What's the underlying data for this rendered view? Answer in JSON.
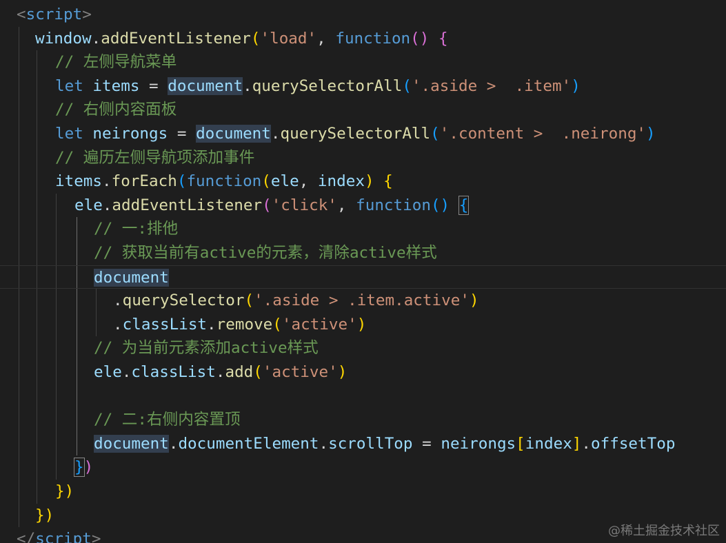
{
  "editor": {
    "theme": {
      "background": "#1e1e1e",
      "tag": "#569cd6",
      "keyword": "#569cd6",
      "variable": "#9cdcfe",
      "function": "#dcdcaa",
      "string": "#ce9178",
      "comment": "#6a9955",
      "plain": "#d4d4d4",
      "bracket_level_1": "#ffd700",
      "bracket_level_2": "#da70d6",
      "bracket_level_3": "#179fff"
    },
    "lines": [
      [
        [
          "<",
          "punct"
        ],
        [
          "script",
          "tag"
        ],
        [
          ">",
          "punct"
        ]
      ],
      [
        [
          "window",
          "var"
        ],
        [
          ".",
          "plain"
        ],
        [
          "addEventListener",
          "fn"
        ],
        [
          "(",
          "b1"
        ],
        [
          "'load'",
          "str"
        ],
        [
          ", ",
          "plain"
        ],
        [
          "function",
          "kw"
        ],
        [
          "()",
          "b2"
        ],
        [
          " ",
          "plain"
        ],
        [
          "{",
          "b2"
        ]
      ],
      [
        [
          "// 左侧导航菜单",
          "com"
        ]
      ],
      [
        [
          "let",
          "kw"
        ],
        [
          " ",
          "plain"
        ],
        [
          "items",
          "var"
        ],
        [
          " = ",
          "plain"
        ],
        [
          "document",
          "var",
          "sel"
        ],
        [
          ".",
          "plain"
        ],
        [
          "querySelectorAll",
          "fn"
        ],
        [
          "(",
          "b3"
        ],
        [
          "'.aside >  .item'",
          "str"
        ],
        [
          ")",
          "b3"
        ]
      ],
      [
        [
          "// 右侧内容面板",
          "com"
        ]
      ],
      [
        [
          "let",
          "kw"
        ],
        [
          " ",
          "plain"
        ],
        [
          "neirongs",
          "var"
        ],
        [
          " = ",
          "plain"
        ],
        [
          "document",
          "var",
          "sel"
        ],
        [
          ".",
          "plain"
        ],
        [
          "querySelectorAll",
          "fn"
        ],
        [
          "(",
          "b3"
        ],
        [
          "'.content >  .neirong'",
          "str"
        ],
        [
          ")",
          "b3"
        ]
      ],
      [
        [
          "// 遍历左侧导航项添加事件",
          "com"
        ]
      ],
      [
        [
          "items",
          "var"
        ],
        [
          ".",
          "plain"
        ],
        [
          "forEach",
          "fn"
        ],
        [
          "(",
          "b3"
        ],
        [
          "function",
          "kw"
        ],
        [
          "(",
          "b1"
        ],
        [
          "ele",
          "var"
        ],
        [
          ", ",
          "plain"
        ],
        [
          "index",
          "var"
        ],
        [
          ")",
          "b1"
        ],
        [
          " ",
          "plain"
        ],
        [
          "{",
          "b1"
        ]
      ],
      [
        [
          "ele",
          "var"
        ],
        [
          ".",
          "plain"
        ],
        [
          "addEventListener",
          "fn"
        ],
        [
          "(",
          "b2"
        ],
        [
          "'click'",
          "str"
        ],
        [
          ", ",
          "plain"
        ],
        [
          "function",
          "kw"
        ],
        [
          "()",
          "b3"
        ],
        [
          " ",
          "plain"
        ],
        [
          "{",
          "b3",
          "bracket"
        ]
      ],
      [
        [
          "// 一:排他",
          "com"
        ]
      ],
      [
        [
          "// 获取当前有active的元素，清除active样式",
          "com"
        ]
      ],
      [
        [
          "document",
          "var",
          "sel"
        ]
      ],
      [
        [
          ".",
          "plain"
        ],
        [
          "querySelector",
          "fn"
        ],
        [
          "(",
          "b1"
        ],
        [
          "'.aside > .item.active'",
          "str"
        ],
        [
          ")",
          "b1"
        ]
      ],
      [
        [
          ".",
          "plain"
        ],
        [
          "classList",
          "var"
        ],
        [
          ".",
          "plain"
        ],
        [
          "remove",
          "fn"
        ],
        [
          "(",
          "b1"
        ],
        [
          "'active'",
          "str"
        ],
        [
          ")",
          "b1"
        ]
      ],
      [
        [
          "// 为当前元素添加active样式",
          "com"
        ]
      ],
      [
        [
          "ele",
          "var"
        ],
        [
          ".",
          "plain"
        ],
        [
          "classList",
          "var"
        ],
        [
          ".",
          "plain"
        ],
        [
          "add",
          "fn"
        ],
        [
          "(",
          "b1"
        ],
        [
          "'active'",
          "str"
        ],
        [
          ")",
          "b1"
        ]
      ],
      [],
      [
        [
          "// 二:右侧内容置顶",
          "com"
        ]
      ],
      [
        [
          "document",
          "var",
          "sel"
        ],
        [
          ".",
          "plain"
        ],
        [
          "documentElement",
          "var"
        ],
        [
          ".",
          "plain"
        ],
        [
          "scrollTop",
          "var"
        ],
        [
          " = ",
          "plain"
        ],
        [
          "neirongs",
          "var"
        ],
        [
          "[",
          "b1"
        ],
        [
          "index",
          "var"
        ],
        [
          "]",
          "b1"
        ],
        [
          ".",
          "plain"
        ],
        [
          "offsetTop",
          "var"
        ]
      ],
      [
        [
          "}",
          "b3",
          "bracket"
        ],
        [
          ")",
          "b2"
        ]
      ],
      [
        [
          "})",
          "b1"
        ]
      ],
      [
        [
          "})",
          "b1"
        ]
      ],
      [
        [
          "</",
          "punct"
        ],
        [
          "script",
          "tag"
        ],
        [
          ">",
          "punct"
        ]
      ]
    ]
  },
  "watermark": {
    "text": "@稀土掘金技术社区"
  }
}
